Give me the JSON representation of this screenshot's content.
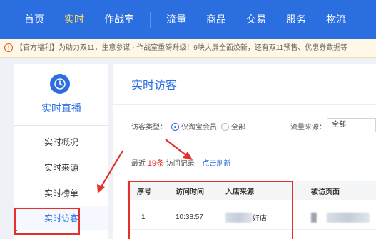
{
  "topnav": {
    "items": [
      {
        "label": "首页",
        "active": false
      },
      {
        "label": "实时",
        "active": true
      },
      {
        "label": "作战室",
        "active": false
      },
      {
        "label": "流量",
        "active": false
      },
      {
        "label": "商品",
        "active": false
      },
      {
        "label": "交易",
        "active": false
      },
      {
        "label": "服务",
        "active": false
      },
      {
        "label": "物流",
        "active": false
      }
    ]
  },
  "notice": {
    "icon": "warning-circle-icon",
    "text": "【官方福利】为助力双11，生意参谋 - 作战室重磅升级！9块大屏全面焕新，还有双11预售、优惠券数据等"
  },
  "sidebar": {
    "icon": "clock-icon",
    "title": "实时直播",
    "items": [
      {
        "label": "实时概况"
      },
      {
        "label": "实时来源"
      },
      {
        "label": "实时榜单"
      },
      {
        "label": "实时访客",
        "active": true
      }
    ]
  },
  "main": {
    "title": "实时访客",
    "filter": {
      "visitor_type_label": "访客类型：",
      "option_member": "仅淘宝会员",
      "option_all": "全部",
      "source_label": "流量来源：",
      "source_value": "全部"
    },
    "recent": {
      "prefix": "最近",
      "count": "19条",
      "suffix": "访问记录",
      "refresh": "点击刷新"
    },
    "table": {
      "columns": [
        "序号",
        "访问时间",
        "入店来源",
        "被访页面"
      ],
      "rows": [
        {
          "index": "1",
          "time": "10:38:57",
          "source": "好店"
        }
      ]
    }
  },
  "colors": {
    "brand_blue": "#2b6ee0",
    "active_nav": "#ffe15a",
    "annotation_red": "#e5302a"
  }
}
